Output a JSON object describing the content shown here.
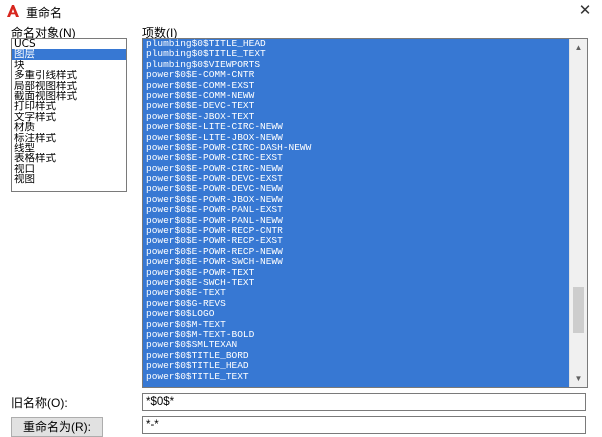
{
  "window": {
    "title": "重命名",
    "close_glyph": "✕",
    "app_icon": "autocad-a-icon"
  },
  "named_objects": {
    "label": "命名对象(N)",
    "items": [
      "UCS",
      "图层",
      "块",
      "多重引线样式",
      "局部视图样式",
      "截面视图样式",
      "打印样式",
      "文字样式",
      "材质",
      "标注样式",
      "线型",
      "表格样式",
      "视口",
      "视图"
    ],
    "selected": "图层"
  },
  "items": {
    "label": "项数(I)",
    "rows": [
      "plumbing$0$TITLE_HEAD",
      "plumbing$0$TITLE_TEXT",
      "plumbing$0$VIEWPORTS",
      "power$0$E-COMM-CNTR",
      "power$0$E-COMM-EXST",
      "power$0$E-COMM-NEWW",
      "power$0$E-DEVC-TEXT",
      "power$0$E-JBOX-TEXT",
      "power$0$E-LITE-CIRC-NEWW",
      "power$0$E-LITE-JBOX-NEWW",
      "power$0$E-POWR-CIRC-DASH-NEWW",
      "power$0$E-POWR-CIRC-EXST",
      "power$0$E-POWR-CIRC-NEWW",
      "power$0$E-POWR-DEVC-EXST",
      "power$0$E-POWR-DEVC-NEWW",
      "power$0$E-POWR-JBOX-NEWW",
      "power$0$E-POWR-PANL-EXST",
      "power$0$E-POWR-PANL-NEWW",
      "power$0$E-POWR-RECP-CNTR",
      "power$0$E-POWR-RECP-EXST",
      "power$0$E-POWR-RECP-NEWW",
      "power$0$E-POWR-SWCH-NEWW",
      "power$0$E-POWR-TEXT",
      "power$0$E-SWCH-TEXT",
      "power$0$E-TEXT",
      "power$0$G-REVS",
      "power$0$LOGO",
      "power$0$M-TEXT",
      "power$0$M-TEXT-BOLD",
      "power$0$SMLTEXAN",
      "power$0$TITLE_BORD",
      "power$0$TITLE_HEAD",
      "power$0$TITLE_TEXT"
    ],
    "scroll_up_glyph": "▲",
    "scroll_down_glyph": "▼"
  },
  "old_name": {
    "label": "旧名称(O):",
    "value": "*$0$*"
  },
  "rename_to": {
    "button_label": "重命名为(R):",
    "value": "*-*"
  }
}
